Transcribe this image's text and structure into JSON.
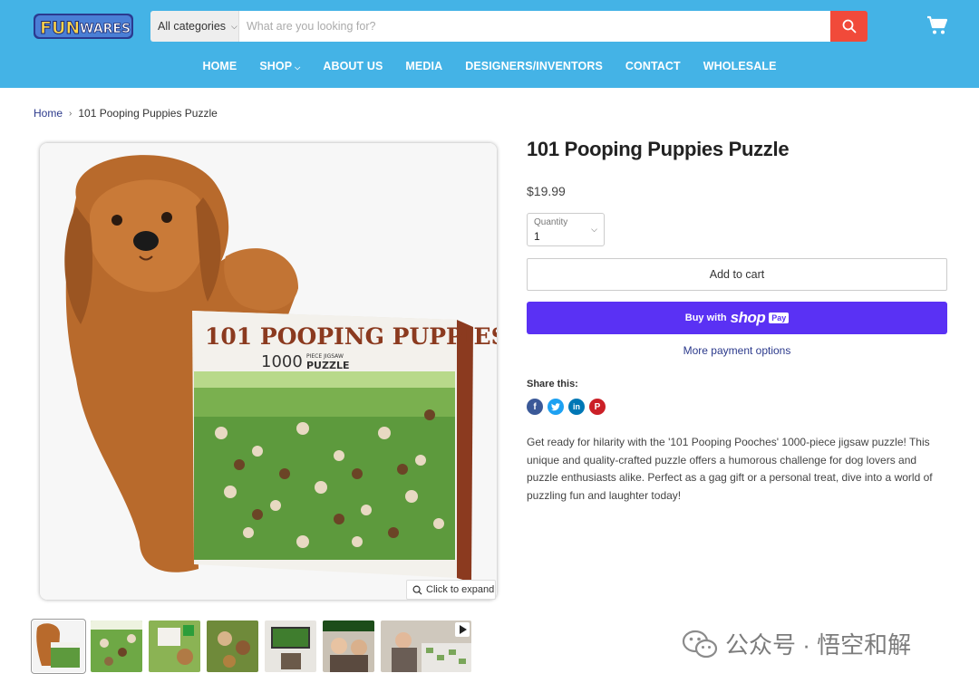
{
  "header": {
    "logo_text": "FUNWARES",
    "search": {
      "category": "All categories",
      "placeholder": "What are you looking for?"
    },
    "nav": [
      {
        "label": "HOME",
        "has_dropdown": false
      },
      {
        "label": "SHOP",
        "has_dropdown": true
      },
      {
        "label": "ABOUT US",
        "has_dropdown": false
      },
      {
        "label": "MEDIA",
        "has_dropdown": false
      },
      {
        "label": "DESIGNERS/INVENTORS",
        "has_dropdown": false
      },
      {
        "label": "CONTACT",
        "has_dropdown": false
      },
      {
        "label": "WHOLESALE",
        "has_dropdown": false
      }
    ],
    "colors": {
      "bar": "#44b3e6",
      "search_button": "#f14a3a"
    }
  },
  "breadcrumb": {
    "home": "Home",
    "current": "101 Pooping Puppies Puzzle"
  },
  "gallery": {
    "box_title": "101 POOPING PUPPIES",
    "box_count": "1000",
    "box_piece": "PIECE JIGSAW",
    "box_puzzle": "PUZZLE",
    "expand_label": "Click to expand",
    "thumbnail_count": 8,
    "active_thumbnail": 1
  },
  "product": {
    "title": "101 Pooping Puppies Puzzle",
    "price": "$19.99",
    "quantity_label": "Quantity",
    "quantity_value": "1",
    "add_to_cart": "Add to cart",
    "shop_pay": {
      "buy": "Buy with",
      "shop": "shop",
      "pay": "Pay"
    },
    "more_payment": "More payment options",
    "share_label": "Share this:",
    "share_icons": [
      "facebook-icon",
      "twitter-icon",
      "linkedin-icon",
      "pinterest-icon"
    ],
    "description": "Get ready for hilarity with the '101 Pooping Pooches' 1000-piece jigsaw puzzle! This unique and quality-crafted puzzle offers a humorous challenge for dog lovers and puzzle enthusiasts alike. Perfect as a gag gift or a personal treat, dive into a world of puzzling fun and laughter today!",
    "colors": {
      "shop_pay": "#5a31f4",
      "link": "#2c3a8c"
    }
  },
  "watermark": {
    "text": "公众号 · 悟空和解"
  }
}
